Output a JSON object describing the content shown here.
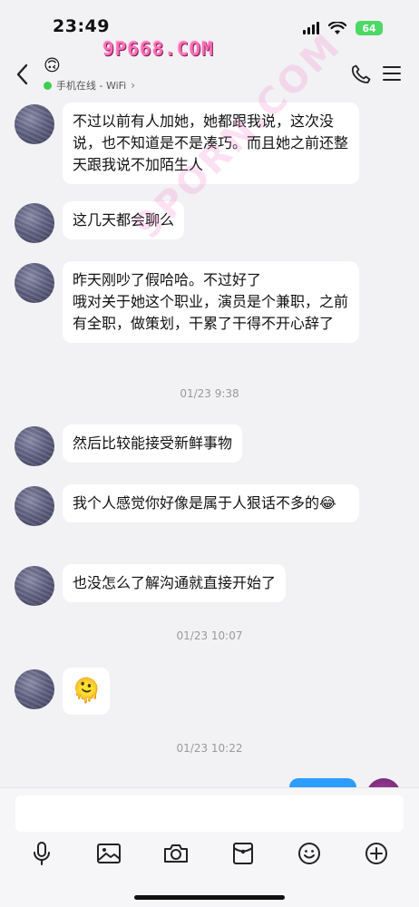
{
  "status_bar": {
    "time": "23:49",
    "battery": "64"
  },
  "header": {
    "contact_emoji": "🙃",
    "online_status": "手机在线 - WiFi",
    "chevron": "›"
  },
  "watermark": {
    "logo": "9P668.COM",
    "diagonal": "9PORN.COM"
  },
  "messages": [
    {
      "type": "in",
      "text": "不过以前有人加她，她都跟我说，这次没说，也不知道是不是凑巧。而且她之前还整天跟我说不加陌生人"
    },
    {
      "type": "in",
      "text": "这几天都会聊么"
    },
    {
      "type": "in",
      "text": "昨天刚吵了假哈哈。不过好了\n哦对关于她这个职业，演员是个兼职，之前有全职，做策划，干累了干得不开心辞了"
    },
    {
      "type": "time",
      "text": "01/23 9:38"
    },
    {
      "type": "in",
      "text": "然后比较能接受新鲜事物"
    },
    {
      "type": "in",
      "text": "我个人感觉你好像是属于人狠话不多的😂"
    },
    {
      "type": "in",
      "text": "也没怎么了解沟通就直接开始了"
    },
    {
      "type": "time",
      "text": "01/23 10:07"
    },
    {
      "type": "in",
      "text": "🫠"
    },
    {
      "type": "time",
      "text": "01/23 10:22"
    }
  ],
  "input": {
    "placeholder": ""
  }
}
